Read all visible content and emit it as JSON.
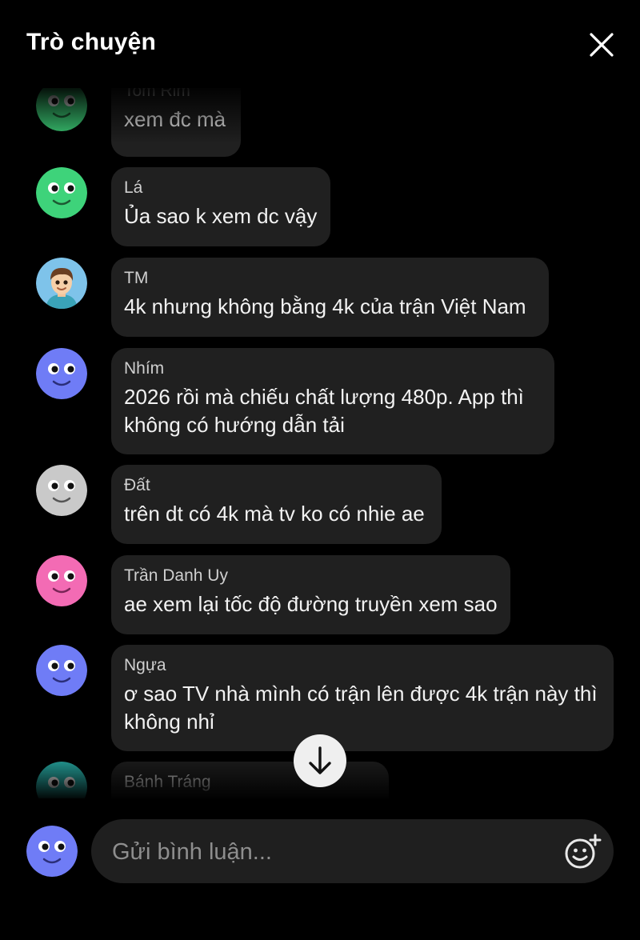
{
  "header": {
    "title": "Trò chuyện"
  },
  "messages": [
    {
      "name": "Tom Rim",
      "text": "xem đc mà",
      "avatar": "smiley-green"
    },
    {
      "name": "Lá",
      "text": "Ủa sao k xem dc vậy",
      "avatar": "smiley-green"
    },
    {
      "name": "TM",
      "text": "4k nhưng không bằng 4k của trận Việt Nam",
      "avatar": "cartoon-boy"
    },
    {
      "name": "Nhím",
      "text_line1": "2026 rồi mà chiếu chất lượng 480p. App thì",
      "text_line2": "không có hướng dẫn tải",
      "avatar": "smiley-blue"
    },
    {
      "name": "Đất",
      "text": "trên dt có 4k mà tv ko có nhie ae",
      "avatar": "smiley-gray"
    },
    {
      "name": "Trần Danh Uy",
      "text": "ae xem lại tốc độ đường truyền xem sao",
      "avatar": "smiley-pink"
    },
    {
      "name": "Ngựa",
      "text_line1": "ơ sao TV nhà mình có trận lên được 4k trận này thì",
      "text_line2": "không nhỉ",
      "avatar": "smiley-blue"
    },
    {
      "name": "Bánh Tráng",
      "avatar": "smiley-teal"
    }
  ],
  "colors": {
    "green": "#3ed37a",
    "blue": "#6f7cf6",
    "gray": "#c9c9c9",
    "pink": "#f36bb4",
    "teal": "#2ab7b0",
    "bubble": "#202020"
  },
  "composer": {
    "placeholder": "Gửi bình luận..."
  },
  "icons": {
    "close": "close-icon",
    "scroll": "arrow-down-icon",
    "emoji": "emoji-add-icon"
  }
}
